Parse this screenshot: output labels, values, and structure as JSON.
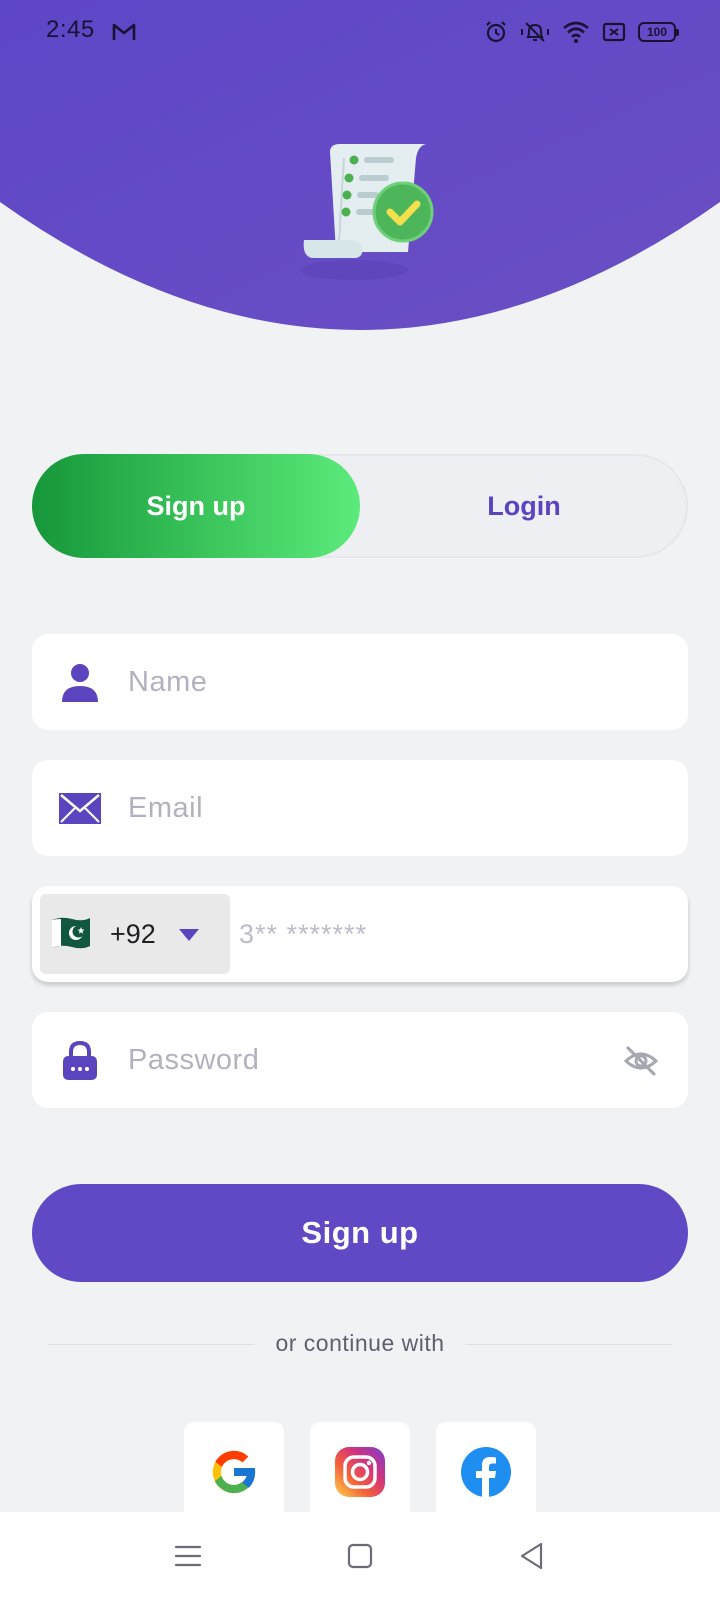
{
  "status_bar": {
    "time": "2:45",
    "battery": "100",
    "icons": [
      "gmail-icon",
      "alarm-icon",
      "vibrate-icon",
      "wifi-icon",
      "sim-icon",
      "battery-icon"
    ]
  },
  "colors": {
    "primary": "#6149c6",
    "accent_green": "#3cc65c",
    "background": "#f1f2f4"
  },
  "tabs": {
    "signup_label": "Sign up",
    "login_label": "Login",
    "active": "signup"
  },
  "form": {
    "name_placeholder": "Name",
    "email_placeholder": "Email",
    "phone": {
      "dial_code": "+92",
      "country_flag": "pakistan-flag-icon",
      "placeholder": "3** *******"
    },
    "password_placeholder": "Password"
  },
  "submit_label": "Sign up",
  "social": {
    "divider_text": "or continue with",
    "providers": [
      "google-icon",
      "instagram-icon",
      "facebook-icon"
    ]
  },
  "nav_bar": {
    "icons": [
      "menu-icon",
      "home-icon",
      "back-icon"
    ]
  }
}
